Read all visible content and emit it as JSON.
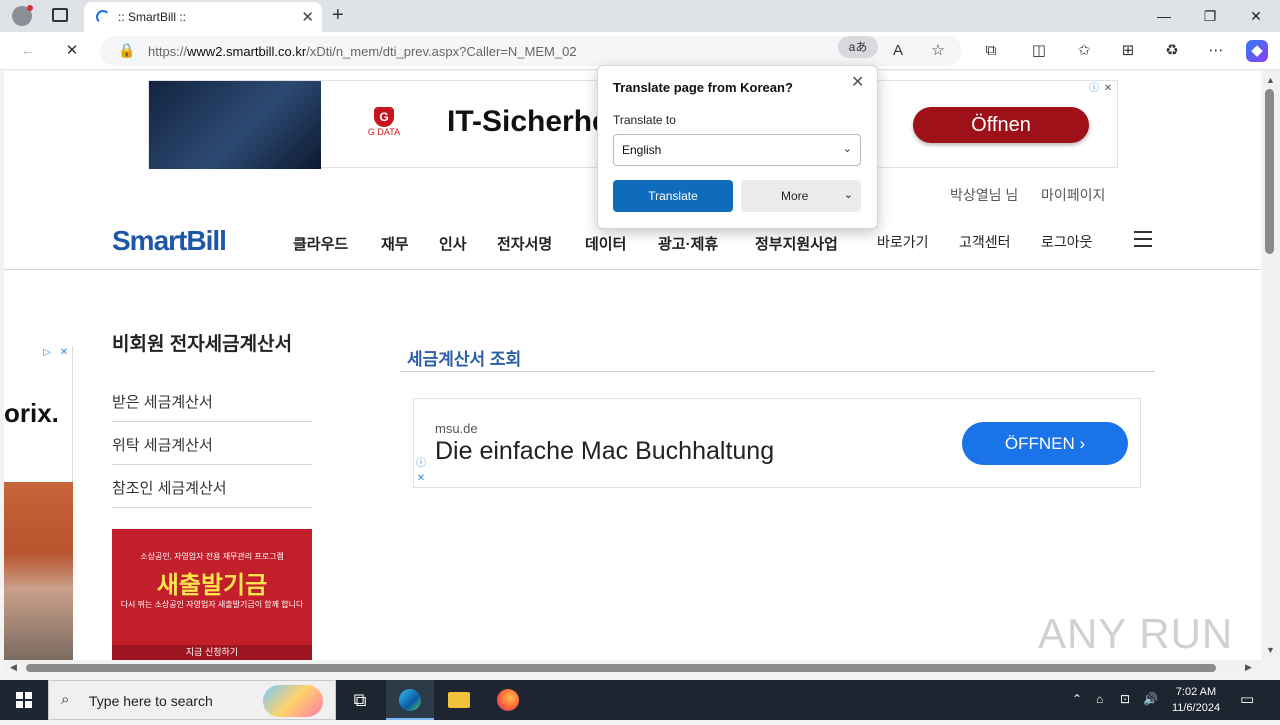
{
  "browser": {
    "tab_title": ":: SmartBill ::",
    "url_prefix": "https://",
    "url_host": "www2.smartbill.co.kr",
    "url_path": "/xDti/n_mem/dti_prev.aspx?Caller=N_MEM_02",
    "translate_button": "aあ"
  },
  "translate_popup": {
    "title": "Translate page from Korean?",
    "label": "Translate to",
    "selected_language": "English",
    "translate_button": "Translate",
    "more_button": "More"
  },
  "ad_top": {
    "brand": "G DATA",
    "brand_sub": "advanced analytics",
    "headline": "IT-Sicherhe",
    "cta": "Öffnen"
  },
  "header": {
    "user": "박상열님 님",
    "mypage": "마이페이지",
    "logo": "SmartBill",
    "nav": [
      "클라우드",
      "재무",
      "인사",
      "전자서명",
      "데이터",
      "광고·제휴",
      "정부지원사업"
    ],
    "nav_light": [
      "바로가기",
      "고객센터",
      "로그아웃"
    ]
  },
  "left_ad": {
    "brand": "orix."
  },
  "sidebar": {
    "title": "비회원 전자세금계산서",
    "items": [
      "받은 세금계산서",
      "위탁 세금계산서",
      "참조인 세금계산서"
    ]
  },
  "side_banner": {
    "line1": "소상공인, 자영업자 전용 재무관리 프로그램",
    "line2": "새출발기금",
    "line3": "다시 뛰는 소상공인 자영업자 새출발기금이 함께 합니다",
    "line4": "지금 신청하기"
  },
  "main": {
    "section_title": "세금계산서 조회"
  },
  "ad_mid": {
    "domain": "msu.de",
    "headline": "Die einfache Mac Buchhaltung",
    "cta": "ÖFFNEN"
  },
  "watermark": "ANY RUN",
  "taskbar": {
    "search_placeholder": "Type here to search",
    "time": "7:02 AM",
    "date": "11/6/2024"
  }
}
